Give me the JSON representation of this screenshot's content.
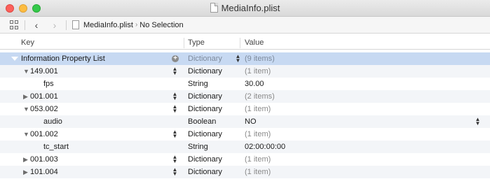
{
  "window": {
    "title": "MediaInfo.plist"
  },
  "jumpbar": {
    "back_icon": "chevron-left-icon",
    "forward_icon": "chevron-right-icon",
    "file": "MediaInfo.plist",
    "selection": "No Selection"
  },
  "columns": {
    "key": "Key",
    "type": "Type",
    "value": "Value"
  },
  "rows": [
    {
      "key": "Information Property List",
      "type": "Dictionary",
      "value": "(9 items)"
    },
    {
      "key": "149.001",
      "type": "Dictionary",
      "value": "(1 item)"
    },
    {
      "key": "fps",
      "type": "String",
      "value": "30.00"
    },
    {
      "key": "001.001",
      "type": "Dictionary",
      "value": "(2 items)"
    },
    {
      "key": "053.002",
      "type": "Dictionary",
      "value": "(1 item)"
    },
    {
      "key": "audio",
      "type": "Boolean",
      "value": "NO"
    },
    {
      "key": "001.002",
      "type": "Dictionary",
      "value": "(1 item)"
    },
    {
      "key": "tc_start",
      "type": "String",
      "value": "02:00:00:00"
    },
    {
      "key": "001.003",
      "type": "Dictionary",
      "value": "(1 item)"
    },
    {
      "key": "101.004",
      "type": "Dictionary",
      "value": "(1 item)"
    }
  ],
  "colors": {
    "selection": "#c7d9f2",
    "alt_row": "#f3f5f8",
    "close": "#fc605b",
    "minimize": "#fdbc40",
    "zoom": "#34c84a"
  }
}
